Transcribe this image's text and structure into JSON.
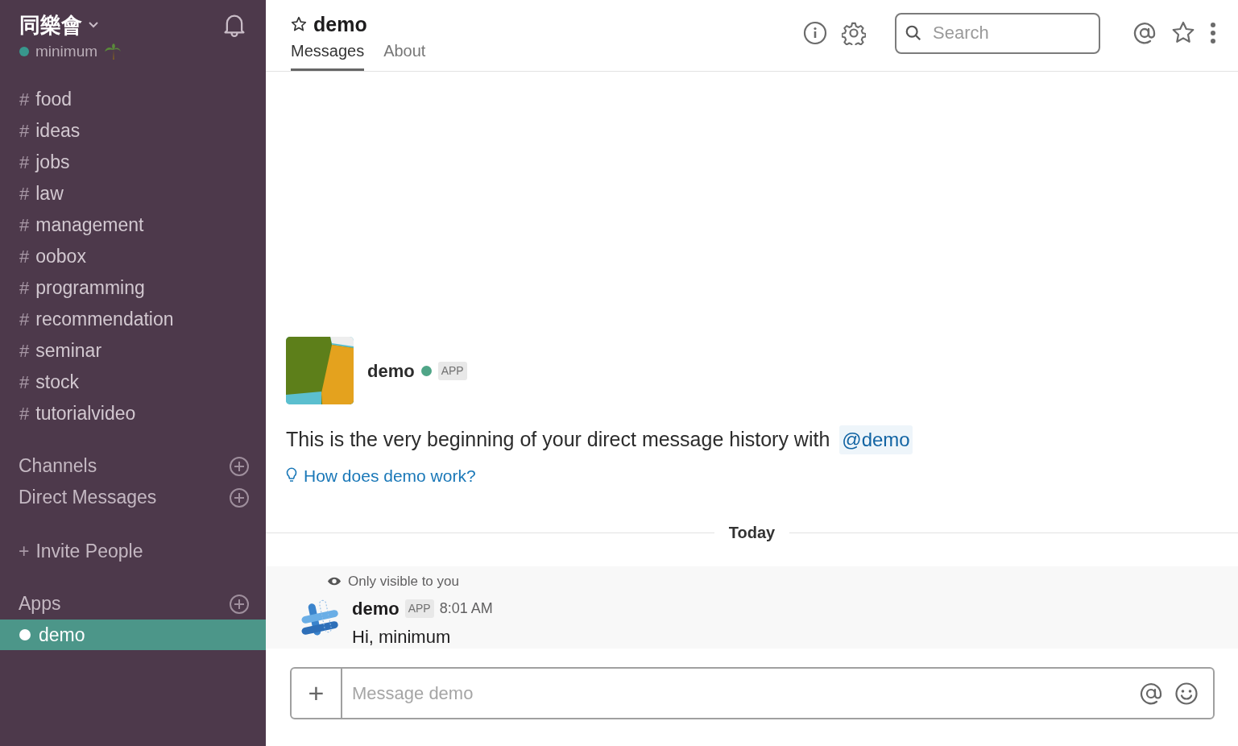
{
  "sidebar": {
    "team": "同樂會",
    "user": {
      "name": "minimum",
      "online": true
    },
    "channels": [
      {
        "name": "food",
        "selected": false
      },
      {
        "name": "ideas",
        "selected": false
      },
      {
        "name": "jobs",
        "selected": false
      },
      {
        "name": "law",
        "selected": false
      },
      {
        "name": "management",
        "selected": false
      },
      {
        "name": "oobox",
        "selected": false
      },
      {
        "name": "programming",
        "selected": false
      },
      {
        "name": "recommendation",
        "selected": false
      },
      {
        "name": "seminar",
        "selected": false
      },
      {
        "name": "stock",
        "selected": false
      },
      {
        "name": "tutorialvideo",
        "selected": false
      }
    ],
    "hash": "#",
    "sections": [
      "Channels",
      "Direct Messages"
    ],
    "invite": {
      "icon": "+",
      "label": "Invite People"
    },
    "apps_heading": "Apps",
    "apps": [
      {
        "name": "demo",
        "selected": true,
        "online": true
      }
    ]
  },
  "header": {
    "title": "demo",
    "tabs": [
      {
        "label": "Messages",
        "selected": true
      },
      {
        "label": "About",
        "selected": false
      }
    ],
    "search": {
      "placeholder": "Search"
    }
  },
  "intro": {
    "name": "demo",
    "online": true,
    "badge": "APP",
    "text": "This is the very beginning of your direct message history with",
    "mention": "@demo",
    "help_link": "How does demo work?"
  },
  "divider": "Today",
  "messages": [
    {
      "note": "Only visible to you",
      "author": "demo",
      "badge": "APP",
      "time": "8:01 AM",
      "text": "Hi, minimum"
    }
  ],
  "composer": {
    "button": "+",
    "placeholder": "Message demo"
  }
}
